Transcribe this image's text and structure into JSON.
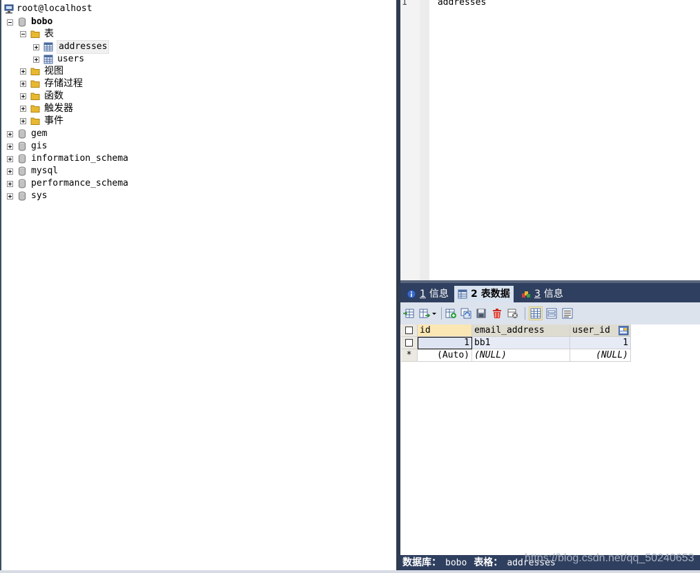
{
  "tree": {
    "root_label": "root@localhost",
    "databases": [
      {
        "name": "bobo",
        "bold": true,
        "expanded": true
      },
      {
        "name": "gem"
      },
      {
        "name": "gis"
      },
      {
        "name": "information_schema"
      },
      {
        "name": "mysql"
      },
      {
        "name": "performance_schema"
      },
      {
        "name": "sys"
      }
    ],
    "bobo_folders": {
      "tables": "表",
      "views": "视图",
      "procedures": "存储过程",
      "functions": "函数",
      "triggers": "触发器",
      "events": "事件"
    },
    "bobo_tables": [
      "addresses",
      "users"
    ]
  },
  "editor": {
    "line_number": "1",
    "code": "`addresses`"
  },
  "tabs": [
    {
      "num": "1",
      "label": "信息",
      "icon": "info-icon"
    },
    {
      "num": "2",
      "label": "表数据",
      "icon": "table-data-icon",
      "active": true
    },
    {
      "num": "3",
      "label": "信息",
      "icon": "table-info-icon"
    }
  ],
  "toolbar_icons": [
    "import-icon",
    "export-icon",
    "insert-row-icon",
    "duplicate-row-icon",
    "save-icon",
    "delete-row-icon",
    "cancel-icon",
    "grid-view-icon",
    "form-view-icon",
    "text-view-icon"
  ],
  "grid": {
    "columns": [
      "id",
      "email_address",
      "user_id"
    ],
    "rows": [
      {
        "id": "1",
        "email_address": "bb1",
        "user_id": "1"
      },
      {
        "marker": "*",
        "id": "(Auto)",
        "email_address": "(NULL)",
        "user_id": "(NULL)"
      }
    ]
  },
  "status": {
    "db_label": "数据库：",
    "db_value": "bobo",
    "table_label": "表格：",
    "table_value": "addresses"
  },
  "watermark": "https://blog.csdn.net/qq_50240653",
  "colors": {
    "dark_navy": "#2f3f5f",
    "folder_yellow": "#e8b830",
    "header_selected": "#fbe7b4"
  }
}
